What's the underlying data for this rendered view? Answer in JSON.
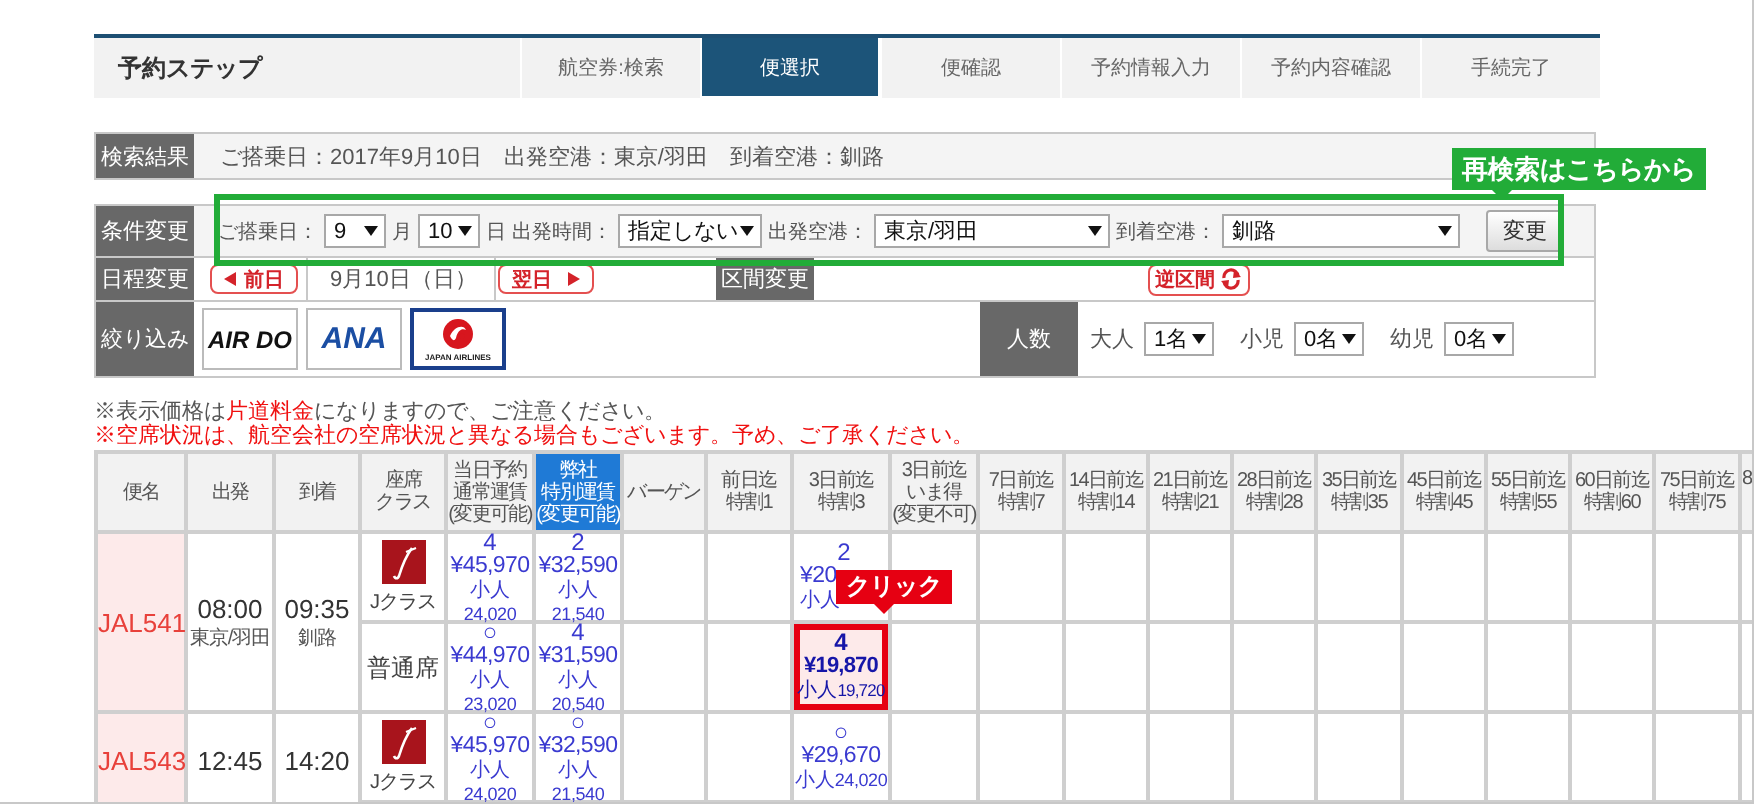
{
  "steps": {
    "title": "予約ステップ",
    "items": [
      {
        "label": "航空券:検索",
        "selected": false
      },
      {
        "label": "便選択",
        "selected": true
      },
      {
        "label": "便確認",
        "selected": false
      },
      {
        "label": "予約情報入力",
        "selected": false
      },
      {
        "label": "予約内容確認",
        "selected": false
      },
      {
        "label": "手続完了",
        "selected": false
      }
    ]
  },
  "search_result": {
    "label": "検索結果",
    "summary": "ご搭乗日：2017年9月10日　出発空港：東京/羽田　到着空港：釧路"
  },
  "conditions": {
    "label": "条件変更",
    "date_label": "ご搭乗日：",
    "month": "9",
    "month_unit": "月",
    "day": "10",
    "day_unit": "日",
    "time_label": "出発時間：",
    "time": "指定しない",
    "departure_label": "出発空港：",
    "departure": "東京/羽田",
    "arrival_label": "到着空港：",
    "arrival": "釧路",
    "button": "変更",
    "callout": "再検索はこちらから"
  },
  "schedule": {
    "label": "日程変更",
    "previous": "前日",
    "date": "9月10日（日）",
    "next": "翌日",
    "route_label": "区間変更",
    "reverse": "逆区間"
  },
  "filter": {
    "label": "絞り込み",
    "airlines": [
      {
        "kind": "airdo",
        "name": "AIR DO",
        "selected": false
      },
      {
        "kind": "ana",
        "name": "ANA",
        "selected": false
      },
      {
        "kind": "jal",
        "name": "JAPAN AIRLINES",
        "selected": true
      }
    ],
    "passengers_label": "人数",
    "passengers": [
      {
        "label": "大人",
        "value": "1名"
      },
      {
        "label": "小児",
        "value": "0名"
      },
      {
        "label": "幼児",
        "value": "0名"
      }
    ]
  },
  "notes": [
    {
      "parts": [
        {
          "text": "※表示価格は",
          "alert": false
        },
        {
          "text": "片道料金",
          "alert": true
        },
        {
          "text": "になりますので、ご注意ください。",
          "alert": false
        }
      ]
    },
    {
      "parts": [
        {
          "text": "※空席状況は、航空会社の空席状況と異なる場合もございます。予め、ご了承ください。",
          "alert": true
        }
      ]
    }
  ],
  "table": {
    "columns": [
      {
        "kind": "info",
        "lines": [
          "便名"
        ],
        "highlighted": false
      },
      {
        "kind": "info",
        "lines": [
          "出発"
        ],
        "highlighted": false
      },
      {
        "kind": "info",
        "lines": [
          "到着"
        ],
        "highlighted": false
      },
      {
        "kind": "info",
        "lines": [
          "座席",
          "クラス"
        ],
        "highlighted": false
      },
      {
        "kind": "fare",
        "lines": [
          "当日予約",
          "通常運賃",
          "(変更可能)"
        ],
        "highlighted": false
      },
      {
        "kind": "fare",
        "lines": [
          "弊社",
          "特別運賃",
          "(変更可能)"
        ],
        "highlighted": true
      },
      {
        "kind": "fare",
        "lines": [
          "バーゲン"
        ],
        "highlighted": false
      },
      {
        "kind": "fare",
        "lines": [
          "前日迄",
          "特割1"
        ],
        "highlighted": false
      },
      {
        "kind": "fare",
        "lines": [
          "3日前迄",
          "特割3"
        ],
        "highlighted": false
      },
      {
        "kind": "fare",
        "lines": [
          "3日前迄",
          "いま得",
          "(変更不可)"
        ],
        "highlighted": false
      },
      {
        "kind": "fare",
        "lines": [
          "7日前迄",
          "特割7"
        ],
        "highlighted": false
      },
      {
        "kind": "fare",
        "lines": [
          "14日前迄",
          "特割14"
        ],
        "highlighted": false
      },
      {
        "kind": "fare",
        "lines": [
          "21日前迄",
          "特割21"
        ],
        "highlighted": false
      },
      {
        "kind": "fare",
        "lines": [
          "28日前迄",
          "特割28"
        ],
        "highlighted": false
      },
      {
        "kind": "fare",
        "lines": [
          "35日前迄",
          "特割35"
        ],
        "highlighted": false
      },
      {
        "kind": "fare",
        "lines": [
          "45日前迄",
          "特割45"
        ],
        "highlighted": false
      },
      {
        "kind": "fare",
        "lines": [
          "55日前迄",
          "特割55"
        ],
        "highlighted": false
      },
      {
        "kind": "fare",
        "lines": [
          "60日前迄",
          "特割60"
        ],
        "highlighted": false
      },
      {
        "kind": "fare",
        "lines": [
          "75日前迄",
          "特割75"
        ],
        "highlighted": false
      },
      {
        "kind": "cut",
        "lines": [
          "8"
        ],
        "highlighted": false
      }
    ],
    "flights": [
      {
        "flight": "JAL541",
        "departure_time": "08:00",
        "departure_airport": "東京/羽田",
        "arrival_time": "09:35",
        "arrival_airport": "釧路",
        "classes": [
          {
            "kind": "j",
            "name": "Jクラス",
            "fares": [
              {
                "kind": "fare",
                "seats": "4",
                "price": "¥45,970",
                "child_label": "小人",
                "child_fare": "24,020",
                "selected": false
              },
              {
                "kind": "fare",
                "seats": "2",
                "price": "¥32,590",
                "child_label": "小人",
                "child_fare": "21,540",
                "selected": false
              },
              {
                "kind": "empty"
              },
              {
                "kind": "empty"
              },
              {
                "kind": "covered",
                "seats": "2",
                "price": "¥20",
                "child_label": "小人",
                "selected": false
              }
            ]
          },
          {
            "kind": "standard",
            "name": "普通席",
            "fares": [
              {
                "kind": "fare",
                "seats": "○",
                "price": "¥44,970",
                "child_label": "小人",
                "child_fare": "23,020",
                "selected": false
              },
              {
                "kind": "fare",
                "seats": "4",
                "price": "¥31,590",
                "child_label": "小人",
                "child_fare": "20,540",
                "selected": false
              },
              {
                "kind": "empty"
              },
              {
                "kind": "empty"
              },
              {
                "kind": "fare",
                "seats": "4",
                "price": "¥19,870",
                "child_label": "小人",
                "child_fare": "19,720",
                "selected": true,
                "callout": "クリック"
              }
            ]
          }
        ]
      },
      {
        "flight": "JAL543",
        "departure_time": "12:45",
        "arrival_time": "14:20",
        "classes": [
          {
            "kind": "j",
            "name": "Jクラス",
            "fares": [
              {
                "kind": "fare",
                "seats": "○",
                "price": "¥45,970",
                "child_label": "小人",
                "child_fare": "24,020",
                "selected": false
              },
              {
                "kind": "fare",
                "seats": "○",
                "price": "¥32,590",
                "child_label": "小人",
                "child_fare": "21,540",
                "selected": false
              },
              {
                "kind": "empty"
              },
              {
                "kind": "empty"
              },
              {
                "kind": "fare",
                "seats": "○",
                "price": "¥29,670",
                "child_label": "小人",
                "child_fare": "24,020",
                "selected": false
              }
            ]
          },
          {
            "kind": "cut"
          }
        ]
      }
    ]
  }
}
